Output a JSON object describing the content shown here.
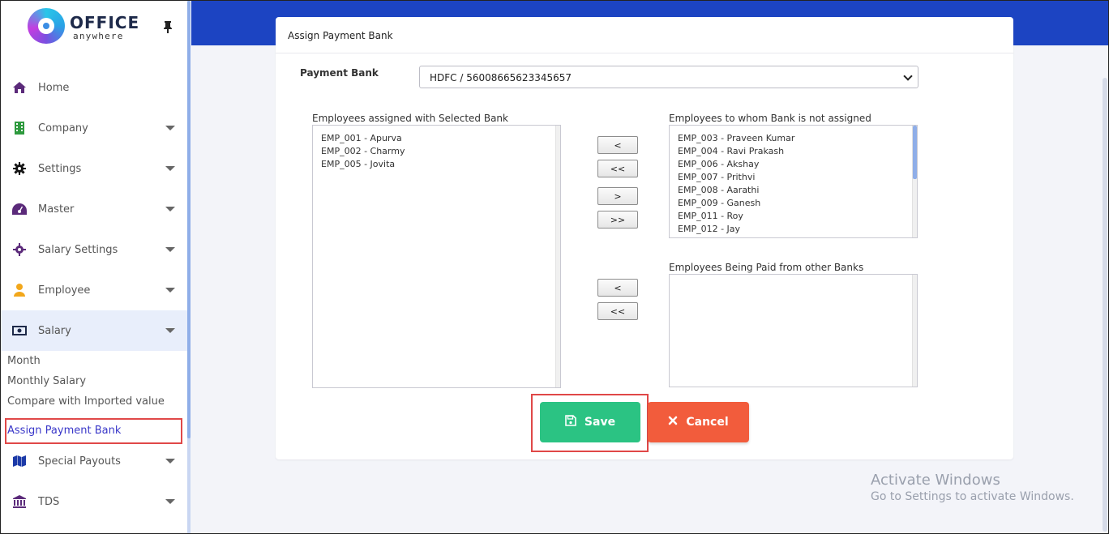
{
  "brand": {
    "name_top": "OFFICE",
    "name_bottom": "anywhere",
    "pin_icon": "pin-icon"
  },
  "sidebar": {
    "items": [
      {
        "label": "Home",
        "icon": "home-icon",
        "caret": false
      },
      {
        "label": "Company",
        "icon": "building-icon",
        "caret": true
      },
      {
        "label": "Settings",
        "icon": "gear-icon",
        "caret": true
      },
      {
        "label": "Master",
        "icon": "dashboard-icon",
        "caret": true
      },
      {
        "label": "Salary Settings",
        "icon": "cog-icon",
        "caret": true
      },
      {
        "label": "Employee",
        "icon": "user-icon",
        "caret": true
      },
      {
        "label": "Salary",
        "icon": "money-icon",
        "caret": true
      },
      {
        "label": "Special Payouts",
        "icon": "map-icon",
        "caret": true
      },
      {
        "label": "TDS",
        "icon": "bank-icon",
        "caret": true
      }
    ],
    "salary_sub": [
      "Month",
      "Monthly Salary",
      "Compare with Imported value",
      "Assign Payment Bank"
    ]
  },
  "card": {
    "title": "Assign Payment Bank",
    "payment_bank_label": "Payment Bank",
    "payment_bank_value": "HDFC / 56008665623345657",
    "assigned_label": "Employees assigned with Selected Bank",
    "assigned": [
      "EMP_001 - Apurva",
      "EMP_002 - Charmy",
      "EMP_005 - Jovita"
    ],
    "unassigned_label": "Employees to whom Bank is not assigned",
    "unassigned": [
      "EMP_003 - Praveen Kumar",
      "EMP_004 - Ravi Prakash",
      "EMP_006 - Akshay",
      "EMP_007 - Prithvi",
      "EMP_008 - Aarathi",
      "EMP_009 - Ganesh",
      "EMP_011 - Roy",
      "EMP_012 - Jay"
    ],
    "other_label": "Employees Being Paid from other Banks",
    "other": [],
    "buttons": {
      "move_left": "<",
      "move_all_left": "<<",
      "move_right": ">",
      "move_all_right": ">>",
      "other_left": "<",
      "other_all_left": "<<"
    },
    "save_label": "Save",
    "cancel_label": "Cancel"
  },
  "watermark": {
    "line1": "Activate Windows",
    "line2": "Go to Settings to activate Windows."
  },
  "colors": {
    "header": "#1c44c2",
    "save": "#2bc383",
    "cancel": "#f25c3c",
    "highlight": "#e04848",
    "link_selected": "#3a38c9"
  }
}
